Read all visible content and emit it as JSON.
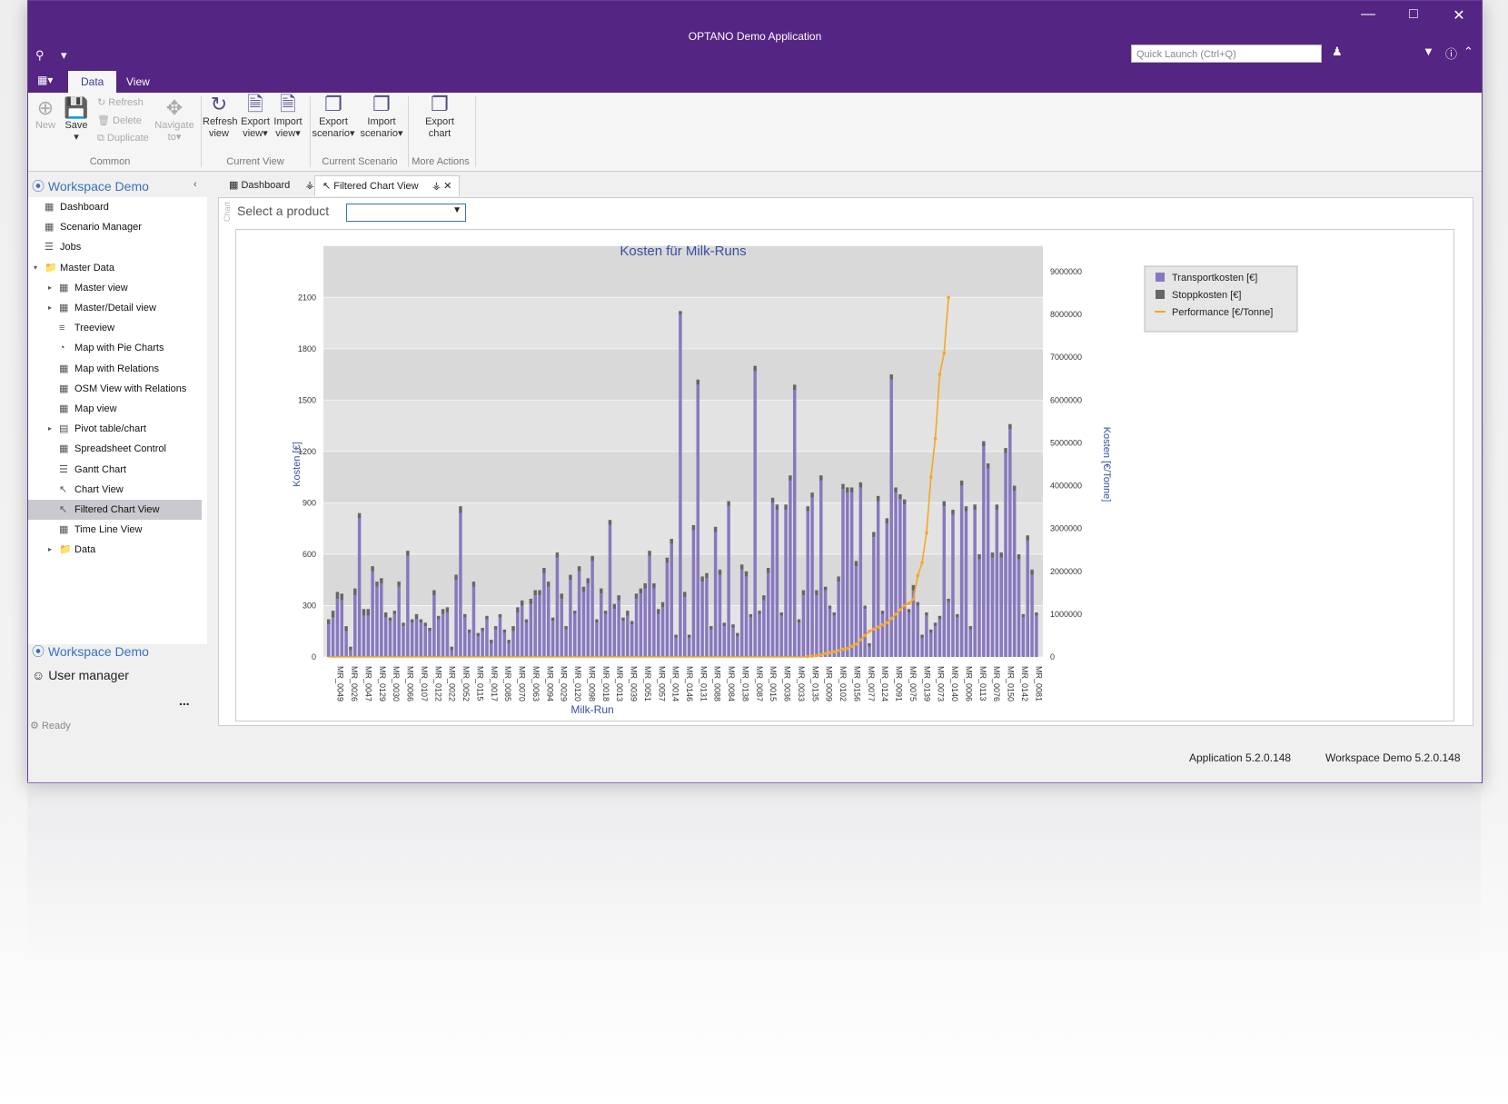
{
  "window": {
    "title": "OPTANO Demo Application",
    "quick_launch_placeholder": "Quick Launch (Ctrl+Q)"
  },
  "ribbon": {
    "tabs": [
      "Data",
      "View"
    ],
    "common": {
      "new": "New",
      "save": "Save",
      "refresh": "Refresh",
      "delete": "Delete",
      "duplicate": "Duplicate",
      "navigate": "Navigate",
      "navigate_to": "to",
      "group": "Common"
    },
    "current_view": {
      "refresh1": "Refresh",
      "refresh2": "view",
      "export1": "Export",
      "export2": "view",
      "import1": "Import",
      "import2": "view",
      "group": "Current View"
    },
    "current_scenario": {
      "export1": "Export",
      "export2": "scenario",
      "import1": "Import",
      "import2": "scenario",
      "group": "Current Scenario"
    },
    "more_actions": {
      "export1": "Export",
      "export2": "chart",
      "group": "More Actions"
    }
  },
  "sidebar": {
    "header": "Workspace Demo",
    "items": [
      "Dashboard",
      "Scenario Manager",
      "Jobs",
      "Master Data",
      "Master view",
      "Master/Detail view",
      "Treeview",
      "Map with Pie Charts",
      "Map with Relations",
      "OSM View with Relations",
      "Map view",
      "Pivot table/chart",
      "Spreadsheet Control",
      "Gantt Chart",
      "Chart View",
      "Filtered Chart View",
      "Time Line View",
      "Data"
    ],
    "bottom_workspace": "Workspace Demo",
    "bottom_user": "User manager",
    "more": "..."
  },
  "doc_tabs": [
    "Dashboard",
    "Filtered Chart View"
  ],
  "filter": {
    "label": "Select a product",
    "side": "Chart"
  },
  "status": "Ready",
  "footer": {
    "app": "Application 5.2.0.148",
    "workspace": "Workspace Demo 5.2.0.148"
  },
  "colors": {
    "accent": "#542582",
    "bar": "#8878bf",
    "stop": "#666666",
    "perf": "#f5a623"
  },
  "chart_data": {
    "type": "bar",
    "title": "Kosten für Milk-Runs",
    "xlabel": "Milk-Run",
    "ylabel": "Kosten [€]",
    "y2label": "Kosten [€/Tonne]",
    "ylim": [
      0,
      2250
    ],
    "y2lim": [
      0,
      9000000
    ],
    "yticks": [
      "0",
      "300",
      "600",
      "900",
      "1200",
      "1500",
      "1800",
      "2100"
    ],
    "y2ticks": [
      "0",
      "1000000",
      "2000000",
      "3000000",
      "4000000",
      "5000000",
      "6000000",
      "7000000",
      "8000000",
      "9000000"
    ],
    "legend_position": "top-right",
    "legend": [
      "Transportkosten [€]",
      "Stoppkosten [€]",
      "Performance [€/Tonne]"
    ],
    "x_tick_labels": [
      "MR_0049",
      "MR_0026",
      "MR_0047",
      "MR_0129",
      "MR_0030",
      "MR_0066",
      "MR_0107",
      "MR_0122",
      "MR_0022",
      "MR_0052",
      "MR_0115",
      "MR_0017",
      "MR_0085",
      "MR_0070",
      "MR_0063",
      "MR_0094",
      "MR_0029",
      "MR_0120",
      "MR_0098",
      "MR_0018",
      "MR_0013",
      "MR_0039",
      "MR_0051",
      "MR_0057",
      "MR_0014",
      "MR_0146",
      "MR_0131",
      "MR_0088",
      "MR_0084",
      "MR_0138",
      "MR_0087",
      "MR_0015",
      "MR_0036",
      "MR_0033",
      "MR_0135",
      "MR_0009",
      "MR_0102",
      "MR_0156",
      "MR_0077",
      "MR_0124",
      "MR_0091",
      "MR_0075",
      "MR_0139",
      "MR_0073",
      "MR_0140",
      "MR_0006",
      "MR_0113",
      "MR_0076",
      "MR_0150",
      "MR_0142",
      "MR_0081"
    ],
    "series": [
      {
        "name": "Transportkosten [€]",
        "values": [
          190,
          230,
          340,
          330,
          150,
          40,
          360,
          810,
          240,
          240,
          500,
          410,
          430,
          230,
          210,
          250,
          410,
          180,
          590,
          200,
          220,
          200,
          180,
          150,
          360,
          220,
          250,
          260,
          40,
          450,
          840,
          230,
          140,
          410,
          120,
          150,
          220,
          80,
          160,
          230,
          140,
          80,
          150,
          260,
          300,
          200,
          310,
          360,
          360,
          490,
          410,
          210,
          580,
          340,
          160,
          450,
          250,
          500,
          380,
          430,
          560,
          200,
          370,
          250,
          770,
          280,
          330,
          210,
          240,
          190,
          340,
          370,
          400,
          590,
          400,
          250,
          290,
          550,
          660,
          110,
          2000,
          350,
          110,
          740,
          1590,
          440,
          460,
          160,
          730,
          480,
          180,
          880,
          170,
          120,
          510,
          470,
          230,
          1670,
          250,
          330,
          490,
          900,
          860,
          240,
          860,
          1030,
          1560,
          200,
          360,
          850,
          930,
          360,
          1030,
          390,
          280,
          240,
          440,
          980,
          960,
          960,
          530,
          990,
          280,
          60,
          700,
          910,
          250,
          780,
          1620,
          960,
          920,
          890,
          260,
          390,
          300,
          110,
          240,
          140,
          180,
          220,
          880,
          320,
          830,
          230,
          1000,
          850,
          160,
          860,
          570,
          1230,
          1100,
          580,
          860,
          580,
          1190,
          1330,
          970,
          570,
          230,
          680,
          480,
          240
        ]
      },
      {
        "name": "Stoppkosten [€]",
        "values": [
          30,
          40,
          40,
          40,
          30,
          20,
          40,
          30,
          40,
          40,
          30,
          30,
          30,
          30,
          20,
          20,
          30,
          20,
          30,
          20,
          30,
          20,
          20,
          20,
          30,
          20,
          30,
          30,
          20,
          30,
          40,
          20,
          20,
          30,
          20,
          20,
          20,
          20,
          20,
          20,
          20,
          20,
          30,
          30,
          30,
          20,
          30,
          30,
          30,
          30,
          30,
          20,
          30,
          30,
          20,
          30,
          20,
          30,
          30,
          30,
          30,
          20,
          30,
          20,
          30,
          30,
          30,
          20,
          30,
          20,
          30,
          30,
          30,
          30,
          30,
          30,
          30,
          30,
          30,
          20,
          20,
          30,
          20,
          30,
          30,
          30,
          30,
          20,
          30,
          30,
          20,
          30,
          20,
          20,
          30,
          30,
          20,
          30,
          20,
          30,
          30,
          30,
          30,
          20,
          30,
          30,
          30,
          20,
          30,
          30,
          30,
          30,
          30,
          20,
          20,
          20,
          30,
          30,
          30,
          30,
          30,
          30,
          20,
          20,
          30,
          30,
          20,
          30,
          30,
          30,
          30,
          30,
          20,
          30,
          20,
          20,
          20,
          20,
          20,
          20,
          30,
          20,
          30,
          20,
          30,
          30,
          20,
          30,
          30,
          30,
          30,
          30,
          30,
          30,
          30,
          30,
          30,
          30,
          20,
          30,
          30,
          20
        ]
      },
      {
        "name": "Performance [€/Tonne]",
        "type": "line",
        "values": [
          0,
          0,
          0,
          0,
          0,
          0,
          0,
          0,
          0,
          0,
          0,
          0,
          0,
          0,
          0,
          0,
          0,
          0,
          0,
          0,
          0,
          0,
          0,
          0,
          0,
          0,
          0,
          0,
          0,
          0,
          0,
          0,
          0,
          0,
          0,
          0,
          0,
          0,
          0,
          0,
          0,
          0,
          0,
          0,
          0,
          0,
          0,
          0,
          0,
          0,
          0,
          0,
          0,
          0,
          0,
          0,
          0,
          0,
          0,
          0,
          0,
          0,
          0,
          0,
          0,
          0,
          0,
          0,
          0,
          0,
          0,
          0,
          0,
          0,
          0,
          0,
          0,
          0,
          0,
          0,
          0,
          0,
          0,
          0,
          0,
          0,
          0,
          0,
          0,
          0,
          0,
          0,
          0,
          0,
          0,
          0,
          0,
          0,
          0,
          0,
          0,
          0,
          0,
          0,
          0,
          0,
          0,
          0,
          0,
          10000,
          20000,
          30000,
          50000,
          80000,
          100000,
          120000,
          150000,
          180000,
          200000,
          250000,
          300000,
          400000,
          500000,
          600000,
          650000,
          700000,
          750000,
          800000,
          900000,
          1000000,
          1100000,
          1200000,
          1250000,
          1350000,
          1900000,
          2200000,
          2900000,
          4200000,
          5100000,
          6600000,
          7100000,
          8400000
        ]
      }
    ]
  }
}
